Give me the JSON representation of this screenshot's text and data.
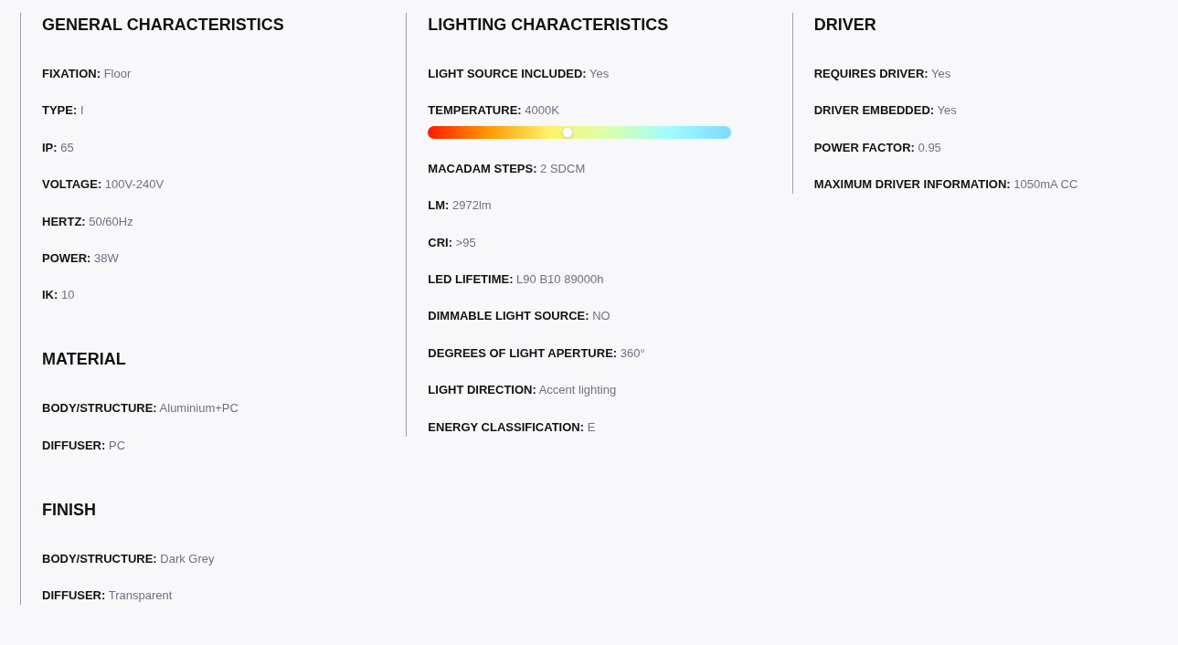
{
  "columns": [
    {
      "sections": [
        {
          "title": "GENERAL CHARACTERISTICS",
          "items": [
            {
              "label": "FIXATION:",
              "value": "Floor"
            },
            {
              "label": "TYPE:",
              "value": "I"
            },
            {
              "label": "IP:",
              "value": "65"
            },
            {
              "label": "VOLTAGE:",
              "value": "100V-240V"
            },
            {
              "label": "HERTZ:",
              "value": "50/60Hz"
            },
            {
              "label": "POWER:",
              "value": "38W"
            },
            {
              "label": "IK:",
              "value": "10"
            }
          ]
        },
        {
          "title": "MATERIAL",
          "items": [
            {
              "label": "BODY/STRUCTURE:",
              "value": "Aluminium+PC"
            },
            {
              "label": "DIFFUSER:",
              "value": "PC"
            }
          ]
        },
        {
          "title": "FINISH",
          "items": [
            {
              "label": "BODY/STRUCTURE:",
              "value": "Dark Grey"
            },
            {
              "label": "DIFFUSER:",
              "value": "Transparent"
            }
          ]
        }
      ]
    },
    {
      "sections": [
        {
          "title": "LIGHTING CHARACTERISTICS",
          "items": [
            {
              "label": "LIGHT SOURCE INCLUDED:",
              "value": "Yes"
            },
            {
              "label": "TEMPERATURE:",
              "value": "4000K",
              "slider": {
                "level": 0.46
              }
            },
            {
              "label": "MACADAM STEPS:",
              "value": "2 SDCM"
            },
            {
              "label": "LM:",
              "value": "2972lm"
            },
            {
              "label": "CRI:",
              "value": ">95"
            },
            {
              "label": "LED LIFETIME:",
              "value": "L90 B10 89000h"
            },
            {
              "label": "DIMMABLE LIGHT SOURCE:",
              "value": "NO"
            },
            {
              "label": "DEGREES OF LIGHT APERTURE:",
              "value": "360°"
            },
            {
              "label": "LIGHT DIRECTION:",
              "value": "Accent lighting"
            },
            {
              "label": "ENERGY CLASSIFICATION:",
              "value": "E"
            }
          ]
        }
      ]
    },
    {
      "sections": [
        {
          "title": "DRIVER",
          "items": [
            {
              "label": "REQUIRES DRIVER:",
              "value": "Yes"
            },
            {
              "label": "DRIVER EMBEDDED:",
              "value": "Yes"
            },
            {
              "label": "POWER FACTOR:",
              "value": "0.95"
            },
            {
              "label": "MAXIMUM DRIVER INFORMATION:",
              "value": "1050mA CC"
            }
          ]
        }
      ]
    }
  ]
}
